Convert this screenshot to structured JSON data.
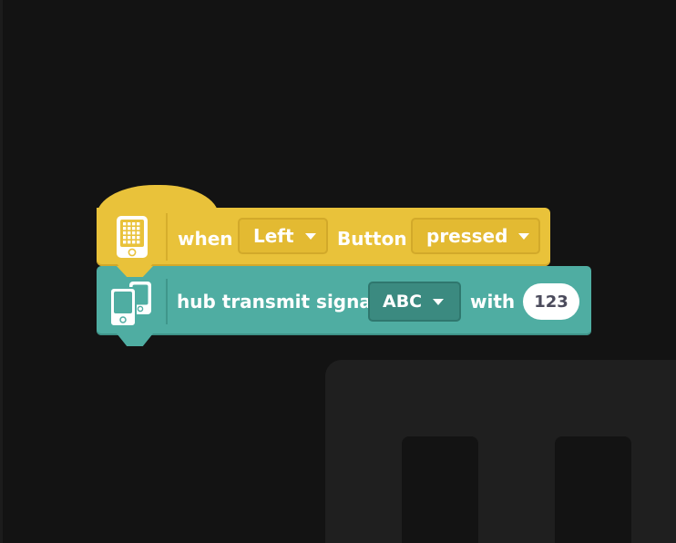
{
  "hat_block": {
    "icon": "hub-icon",
    "when_label": "when",
    "button_dropdown": "Left",
    "button_label": "Button",
    "state_dropdown": "pressed",
    "color": "#e9c23a"
  },
  "action_block": {
    "icon": "hubs-signal-icon",
    "label": "hub transmit signal",
    "signal_dropdown": "ABC",
    "with_label": "with",
    "value": "123",
    "color": "#4fada2"
  }
}
